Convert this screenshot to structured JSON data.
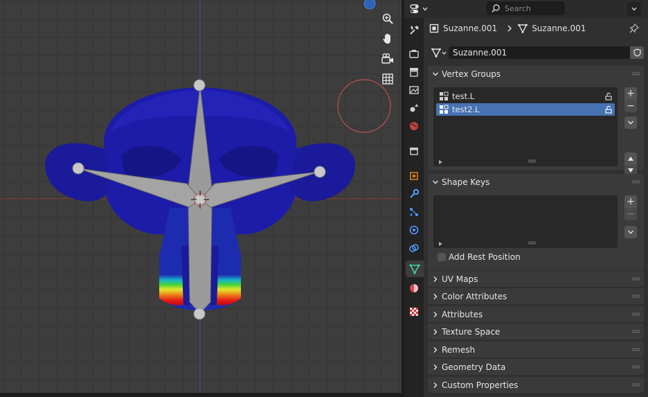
{
  "viewport": {
    "nav_icons": [
      "zoom-icon",
      "hand-pan-icon",
      "camera-view-icon",
      "grid-ortho-icon"
    ]
  },
  "header": {
    "search_placeholder": "Search"
  },
  "breadcrumb": {
    "object_name": "Suzanne.001",
    "mesh_name": "Suzanne.001"
  },
  "datablock": {
    "name": "Suzanne.001"
  },
  "panels": {
    "vertex_groups": {
      "title": "Vertex Groups",
      "items": [
        {
          "label": "test.L",
          "selected": false
        },
        {
          "label": "test2.L",
          "selected": true
        }
      ]
    },
    "shape_keys": {
      "title": "Shape Keys",
      "add_rest_position": "Add Rest Position"
    },
    "collapsed": [
      {
        "title": "UV Maps"
      },
      {
        "title": "Color Attributes"
      },
      {
        "title": "Attributes"
      },
      {
        "title": "Texture Space"
      },
      {
        "title": "Remesh"
      },
      {
        "title": "Geometry Data"
      },
      {
        "title": "Custom Properties"
      }
    ]
  },
  "tabs": [
    "tool",
    "render",
    "output",
    "view-layer",
    "scene",
    "world",
    "collection",
    "object",
    "modifiers",
    "particles",
    "physics",
    "constraints",
    "data",
    "material",
    "texture"
  ],
  "active_tab": "data",
  "colors": {
    "selection": "#4772b3",
    "mesh_blue": "#1a1a9e",
    "bone_gray": "#9b9b9b"
  }
}
